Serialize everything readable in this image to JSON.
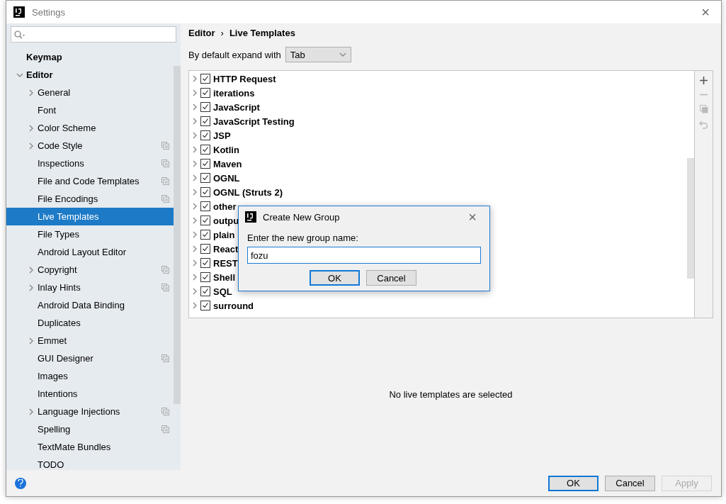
{
  "window": {
    "title": "Settings",
    "close": "×"
  },
  "sidebar": {
    "items": [
      {
        "label": "Keymap",
        "project_icon": false,
        "selected": false
      },
      {
        "label": "Editor",
        "expanded": true,
        "project_icon": false,
        "selected": false,
        "children": [
          {
            "label": "General",
            "expanded": false,
            "project_icon": false,
            "selected": false
          },
          {
            "label": "Font",
            "project_icon": false,
            "selected": false
          },
          {
            "label": "Color Scheme",
            "expanded": false,
            "project_icon": false,
            "selected": false
          },
          {
            "label": "Code Style",
            "expanded": false,
            "project_icon": true,
            "selected": false
          },
          {
            "label": "Inspections",
            "project_icon": true,
            "selected": false
          },
          {
            "label": "File and Code Templates",
            "project_icon": true,
            "selected": false
          },
          {
            "label": "File Encodings",
            "project_icon": true,
            "selected": false
          },
          {
            "label": "Live Templates",
            "project_icon": false,
            "selected": true
          },
          {
            "label": "File Types",
            "project_icon": false,
            "selected": false
          },
          {
            "label": "Android Layout Editor",
            "project_icon": false,
            "selected": false
          },
          {
            "label": "Copyright",
            "expanded": false,
            "project_icon": true,
            "selected": false
          },
          {
            "label": "Inlay Hints",
            "expanded": false,
            "project_icon": true,
            "selected": false
          },
          {
            "label": "Android Data Binding",
            "project_icon": false,
            "selected": false
          },
          {
            "label": "Duplicates",
            "project_icon": false,
            "selected": false
          },
          {
            "label": "Emmet",
            "expanded": false,
            "project_icon": false,
            "selected": false
          },
          {
            "label": "GUI Designer",
            "project_icon": true,
            "selected": false
          },
          {
            "label": "Images",
            "project_icon": false,
            "selected": false
          },
          {
            "label": "Intentions",
            "project_icon": false,
            "selected": false
          },
          {
            "label": "Language Injections",
            "expanded": false,
            "project_icon": true,
            "selected": false
          },
          {
            "label": "Spelling",
            "project_icon": true,
            "selected": false
          },
          {
            "label": "TextMate Bundles",
            "project_icon": false,
            "selected": false
          },
          {
            "label": "TODO",
            "project_icon": false,
            "selected": false
          }
        ]
      }
    ]
  },
  "breadcrumb": {
    "items": [
      "Editor",
      "Live Templates"
    ],
    "separator": "›"
  },
  "expand_with": {
    "label": "By default expand with",
    "value": "Tab"
  },
  "templates": [
    {
      "label": "HTTP Request",
      "checked": true,
      "expanded": false
    },
    {
      "label": "iterations",
      "checked": true,
      "expanded": false
    },
    {
      "label": "JavaScript",
      "checked": true,
      "expanded": false
    },
    {
      "label": "JavaScript Testing",
      "checked": true,
      "expanded": false
    },
    {
      "label": "JSP",
      "checked": true,
      "expanded": false
    },
    {
      "label": "Kotlin",
      "checked": true,
      "expanded": false
    },
    {
      "label": "Maven",
      "checked": true,
      "expanded": false
    },
    {
      "label": "OGNL",
      "checked": true,
      "expanded": false
    },
    {
      "label": "OGNL (Struts 2)",
      "checked": true,
      "expanded": false
    },
    {
      "label": "other",
      "checked": true,
      "expanded": false
    },
    {
      "label": "outpu",
      "checked": true,
      "expanded": false
    },
    {
      "label": "plain",
      "checked": true,
      "expanded": false
    },
    {
      "label": "React",
      "checked": true,
      "expanded": false
    },
    {
      "label": "REST",
      "checked": true,
      "expanded": false
    },
    {
      "label": "Shell",
      "checked": true,
      "expanded": false
    },
    {
      "label": "SQL",
      "checked": true,
      "expanded": false
    },
    {
      "label": "surround",
      "checked": true,
      "expanded": false
    }
  ],
  "empty_message": "No live templates are selected",
  "buttons": [
    {
      "label": "OK",
      "kind": "default",
      "disabled": false
    },
    {
      "label": "Cancel",
      "kind": "normal",
      "disabled": false
    },
    {
      "label": "Apply",
      "kind": "normal",
      "disabled": true
    }
  ],
  "dialog": {
    "title": "Create New Group",
    "close": "×",
    "prompt": "Enter the new group name:",
    "value": "fozu",
    "buttons": [
      {
        "label": "OK",
        "kind": "default"
      },
      {
        "label": "Cancel",
        "kind": "normal"
      }
    ]
  }
}
